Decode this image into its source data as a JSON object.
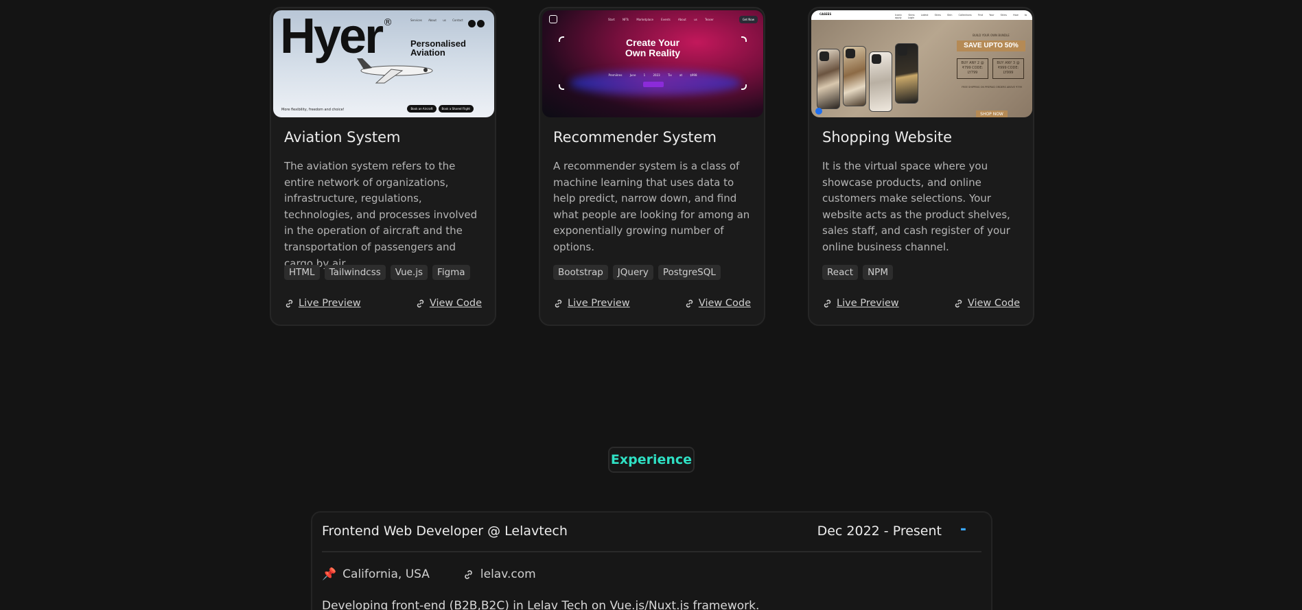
{
  "projects": [
    {
      "title": "Aviation System",
      "description": "The aviation system refers to the entire network of organizations, infrastructure, regulations, technologies, and processes involved in the operation of aircraft and the transportation of passengers and cargo by air.",
      "tags": [
        "HTML",
        "Tailwindcss",
        "Vue.js",
        "Figma"
      ],
      "thumb": {
        "brand": "Hyer",
        "reg": "®",
        "tagline": "Personalised Aviation",
        "nav": "Services About us Contact",
        "footer": "More flexibility, freedom and choice!",
        "pill1": "Book an Aircraft",
        "pill2": "Book a Shared Flight"
      }
    },
    {
      "title": "Recommender System",
      "description": "A recommender system is a class of machine learning that uses data to help predict, narrow down, and find what people are looking for among an exponentially growing number of options.",
      "tags": [
        "Bootstrap",
        "JQuery",
        "PostgreSQL"
      ],
      "thumb": {
        "headline": "Create Your Own Reality",
        "nav": "Start NFTs Marketplace Events About us Teaser",
        "button": "Get Now",
        "sub": "Premières June 1 2023 Tix at $998"
      }
    },
    {
      "title": "Shopping Website",
      "description": "It is the virtual space where you showcase products, and online customers make selections. Your website acts as the product shelves, sales staff, and cash register of your online business channel.",
      "tags": [
        "React",
        "NPM"
      ],
      "thumb": {
        "logo": "CASEES",
        "nav": "Iconic Skins Latest Skins Skin Collections Find Your Skins How to apply Login",
        "build": "BUILD YOUR OWN BUNDLE",
        "save": "SAVE UPTO 50%",
        "offer1": "BUY ANY 2 @ ₹799 CODE: LY799",
        "offer2": "BUY ANY 3 @ ₹999 CODE: LY999",
        "ship": "FREE SHIPPING ON PREPAID ORDERS ABOVE ₹799",
        "shop": "SHOP NOW"
      }
    }
  ],
  "links": {
    "live": "Live Preview",
    "code": "View Code"
  },
  "experience": {
    "badge": "Experience",
    "role": "Frontend Web Developer @ Lelavtech",
    "date": "Dec 2022 - Present",
    "toggle": "-",
    "location": "California, USA",
    "website": "lelav.com",
    "summary": "Developing front-end (B2B,B2C) in Lelav Tech on Vue.js/Nuxt.js framework."
  },
  "colors": {
    "background": "#141414",
    "accent": "#2fe0c4",
    "toggle": "#3aa8ff"
  }
}
